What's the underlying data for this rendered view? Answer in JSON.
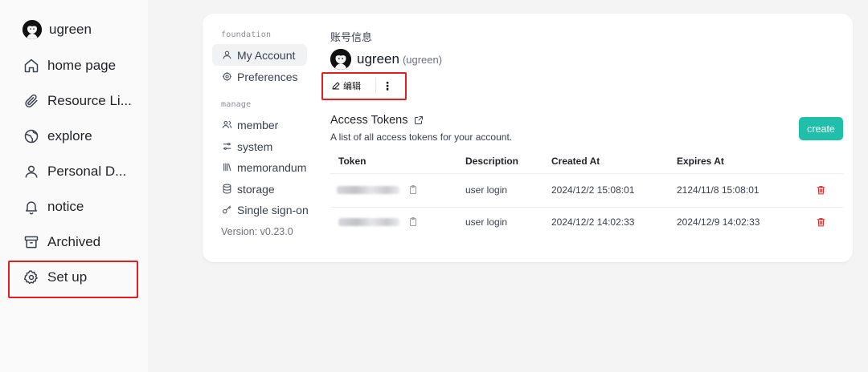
{
  "sidebar": {
    "user": "ugreen",
    "items": [
      {
        "label": "home page",
        "icon": "home-icon"
      },
      {
        "label": "Resource Li...",
        "icon": "paperclip-icon"
      },
      {
        "label": "explore",
        "icon": "globe-icon"
      },
      {
        "label": "Personal D...",
        "icon": "user-icon"
      },
      {
        "label": "notice",
        "icon": "bell-icon"
      },
      {
        "label": "Archived",
        "icon": "archive-icon"
      },
      {
        "label": "Set up",
        "icon": "gear-icon"
      }
    ]
  },
  "settings_nav": {
    "section_foundation": "foundation",
    "section_manage": "manage",
    "items": [
      {
        "label": "My Account",
        "icon": "user-icon",
        "active": true
      },
      {
        "label": "Preferences",
        "icon": "cog-icon"
      },
      {
        "label": "member",
        "icon": "users-icon"
      },
      {
        "label": "system",
        "icon": "sliders-icon"
      },
      {
        "label": "memorandum",
        "icon": "library-icon"
      },
      {
        "label": "storage",
        "icon": "database-icon"
      },
      {
        "label": "Single sign-on",
        "icon": "key-icon"
      }
    ],
    "version": "Version: v0.23.0"
  },
  "account": {
    "title": "账号信息",
    "username": "ugreen",
    "handle": "(ugreen)",
    "edit_label": "编辑",
    "more_label": "⋮"
  },
  "tokens": {
    "title": "Access Tokens",
    "subtitle": "A list of all access tokens for your account.",
    "create_label": "create",
    "columns": [
      "Token",
      "Description",
      "Created At",
      "Expires At"
    ],
    "rows": [
      {
        "description": "user login",
        "created": "2024/12/2 15:08:01",
        "expires": "2124/11/8 15:08:01"
      },
      {
        "description": "user login",
        "created": "2024/12/2 14:02:33",
        "expires": "2024/12/9 14:02:33"
      }
    ]
  },
  "colors": {
    "accent": "#1fbfa9",
    "highlight": "#e02020",
    "delete": "#dc2626"
  }
}
